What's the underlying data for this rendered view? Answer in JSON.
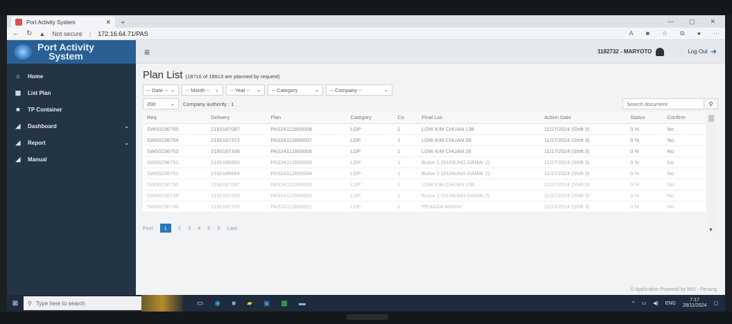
{
  "browser": {
    "tab_title": "Port Activity System",
    "security_text": "Not secure",
    "url": "172.16.64.71/PAS"
  },
  "app": {
    "brand_title": "Port Activity\nSystem",
    "user_label": "1182732 - MARYOTO",
    "logout_label": "Log Out",
    "footer": "© Application Powered by MIS - Penang"
  },
  "sidebar": {
    "items": [
      {
        "label": "Home",
        "icon": "home-icon"
      },
      {
        "label": "List Plan",
        "icon": "calendar-icon"
      },
      {
        "label": "TP Container",
        "icon": "truck-icon"
      },
      {
        "label": "Dashboard",
        "icon": "car-icon"
      },
      {
        "label": "Report",
        "icon": "car-icon"
      },
      {
        "label": "Manual",
        "icon": "car-icon"
      }
    ]
  },
  "page": {
    "title": "Plan List",
    "subtitle": "(18716 of 18913 are planned by request)",
    "filters": [
      "-- Date --",
      "-- Month --",
      "-- Year --",
      "-- Category",
      "-- Company --"
    ],
    "page_size": "200",
    "company_authority": "Company authority : 1",
    "search_placeholder": "Search document"
  },
  "table": {
    "headers": [
      "Req",
      "Delivery",
      "Plan",
      "Category",
      "Co",
      "Final Loc",
      "Action Date",
      "Status",
      "Confirm"
    ],
    "rows": [
      [
        "SW00236755",
        "2160187087",
        "PAS24112800008",
        "LOP",
        "1",
        "LOW KIM CHUAN 138",
        "11/27/2024 (Shift 3)",
        "0 %",
        "No"
      ],
      [
        "SW00236754",
        "2160187372",
        "PAS24112800007",
        "LOP",
        "1",
        "LOW KIM CHUAN 28",
        "11/27/2024 (Shift 3)",
        "0 %",
        "No"
      ],
      [
        "SW00236753",
        "2160187339",
        "PAS24112800006",
        "LOP",
        "1",
        "LOW KIM CHUAN 28",
        "11/27/2024 (Shift 3)",
        "0 %",
        "No"
      ],
      [
        "SW00236752",
        "2160186665",
        "PAS24112800005",
        "LOP",
        "1",
        "Buton 1 (GUNUNG DAMAI 2)",
        "11/27/2024 (Shift 3)",
        "0 %",
        "No"
      ],
      [
        "SW00236751",
        "2160186664",
        "PAS24112800004",
        "LOP",
        "1",
        "Buton 1 (GUNUNG DAMAI 2)",
        "11/27/2024 (Shift 3)",
        "0 %",
        "No"
      ],
      [
        "SW00236750",
        "2160187087",
        "PAS24112800003",
        "LOP",
        "1",
        "LOW KIM CHUAN 138",
        "11/27/2024 (Shift 3)",
        "0 %",
        "No"
      ],
      [
        "SW00236749",
        "2160187355",
        "PAS24112800002",
        "LOP",
        "1",
        "Buton 1 (GUNUNG DAMAI 2)",
        "11/27/2024 (Shift 3)",
        "0 %",
        "No"
      ],
      [
        "SW00236748",
        "2160187270",
        "PAS24112800001",
        "LOP",
        "1",
        "PENAGA WARNI",
        "11/27/2024 (Shift 3)",
        "0 %",
        "No"
      ]
    ]
  },
  "pager": {
    "first": "First",
    "pages": [
      "1",
      "2",
      "3",
      "4",
      "5",
      "6"
    ],
    "last": "Last"
  },
  "taskbar": {
    "search_placeholder": "Type here to search",
    "lang": "ENG",
    "time": "7:17",
    "date": "28/11/2024"
  }
}
